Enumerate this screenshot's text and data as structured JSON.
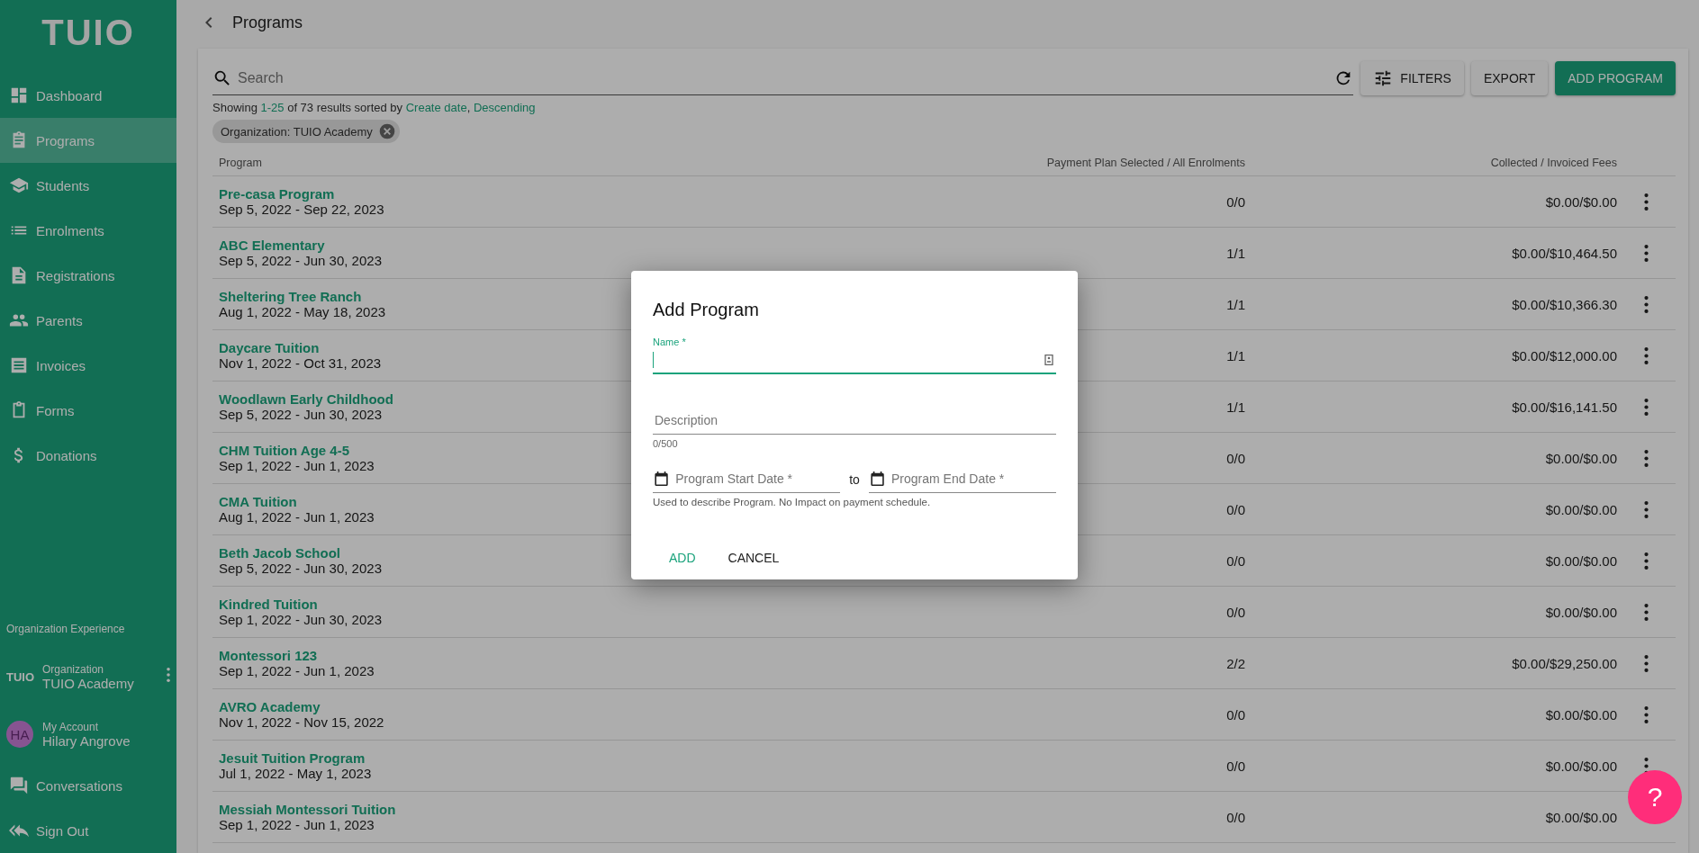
{
  "sidebar": {
    "logo": "TUIO",
    "items": [
      {
        "label": "Dashboard",
        "selected": false
      },
      {
        "label": "Programs",
        "selected": true
      },
      {
        "label": "Students",
        "selected": false
      },
      {
        "label": "Enrolments",
        "selected": false
      },
      {
        "label": "Registrations",
        "selected": false
      },
      {
        "label": "Parents",
        "selected": false
      },
      {
        "label": "Invoices",
        "selected": false
      },
      {
        "label": "Forms",
        "selected": false
      },
      {
        "label": "Donations",
        "selected": false
      }
    ],
    "section_title": "Organization Experience",
    "organization": {
      "logo": "TUIO",
      "caption": "Organization",
      "name": "TUIO Academy"
    },
    "account": {
      "initials": "HA",
      "caption": "My Account",
      "name": "Hilary Angrove"
    },
    "bottom_items": [
      {
        "label": "Conversations"
      },
      {
        "label": "Sign Out"
      }
    ]
  },
  "header": {
    "title": "Programs"
  },
  "toolbar": {
    "search": {
      "placeholder": "Search"
    },
    "buttons": [
      {
        "label": "FILTERS",
        "kind": "filters"
      },
      {
        "label": "EXPORT",
        "kind": "plain"
      },
      {
        "label": "ADD PROGRAM",
        "kind": "primary"
      }
    ]
  },
  "summary": {
    "prefix": "Showing",
    "range": "1-25",
    "middle": "of 73 results sorted by",
    "sort_field": "Create date",
    "separator": ",",
    "sort_order": "Descending"
  },
  "filter_chips": [
    "Organization: TUIO Academy"
  ],
  "table": {
    "columns": [
      "Program",
      "Payment Plan Selected / All Enrolments",
      "Collected / Invoiced Fees"
    ],
    "rows": [
      {
        "name": "Pre-casa Program",
        "dates": "Sep 5, 2022 - Sep 22, 2023",
        "plans": "0/0",
        "fees": "$0.00/$0.00"
      },
      {
        "name": "ABC Elementary",
        "dates": "Sep 5, 2022 - Jun 30, 2023",
        "plans": "1/1",
        "fees": "$0.00/$10,464.50"
      },
      {
        "name": "Sheltering Tree Ranch",
        "dates": "Aug 1, 2022 - May 18, 2023",
        "plans": "1/1",
        "fees": "$0.00/$10,366.30"
      },
      {
        "name": "Daycare Tuition",
        "dates": "Nov 1, 2022 - Oct 31, 2023",
        "plans": "1/1",
        "fees": "$0.00/$12,000.00"
      },
      {
        "name": "Woodlawn Early Childhood",
        "dates": "Sep 5, 2022 - Jun 30, 2023",
        "plans": "1/1",
        "fees": "$0.00/$16,141.50"
      },
      {
        "name": "CHM Tuition Age 4-5",
        "dates": "Sep 1, 2022 - Jun 1, 2023",
        "plans": "0/0",
        "fees": "$0.00/$0.00"
      },
      {
        "name": "CMA Tuition",
        "dates": "Aug 1, 2022 - Jun 1, 2023",
        "plans": "0/0",
        "fees": "$0.00/$0.00"
      },
      {
        "name": "Beth Jacob School",
        "dates": "Sep 5, 2022 - Jun 30, 2023",
        "plans": "0/0",
        "fees": "$0.00/$0.00"
      },
      {
        "name": "Kindred Tuition",
        "dates": "Sep 1, 2022 - Jun 30, 2023",
        "plans": "0/0",
        "fees": "$0.00/$0.00"
      },
      {
        "name": "Montessori 123",
        "dates": "Sep 1, 2022 - Jun 1, 2023",
        "plans": "2/2",
        "fees": "$0.00/$29,250.00"
      },
      {
        "name": "AVRO Academy",
        "dates": "Nov 1, 2022 - Nov 15, 2022",
        "plans": "0/0",
        "fees": "$0.00/$0.00"
      },
      {
        "name": "Jesuit Tuition Program",
        "dates": "Jul 1, 2022 - May 1, 2023",
        "plans": "0/0",
        "fees": "$0.00/$0.00"
      },
      {
        "name": "Messiah Montessori Tuition",
        "dates": "Sep 1, 2022 - Jun 1, 2023",
        "plans": "0/0",
        "fees": "$0.00/$0.00"
      }
    ]
  },
  "dialog": {
    "title": "Add Program",
    "name_field": {
      "label": "Name *",
      "focused": true
    },
    "description_field": {
      "placeholder": "Description",
      "counter": "0/500"
    },
    "start_date": {
      "placeholder": "Program Start Date *"
    },
    "range_word": "to",
    "end_date": {
      "placeholder": "Program End Date *"
    },
    "helper": "Used to describe Program. No Impact on payment schedule.",
    "buttons": [
      {
        "label": "ADD",
        "kind": "primary"
      },
      {
        "label": "CANCEL",
        "kind": "plain"
      }
    ]
  },
  "help_button": {
    "label": "?"
  }
}
